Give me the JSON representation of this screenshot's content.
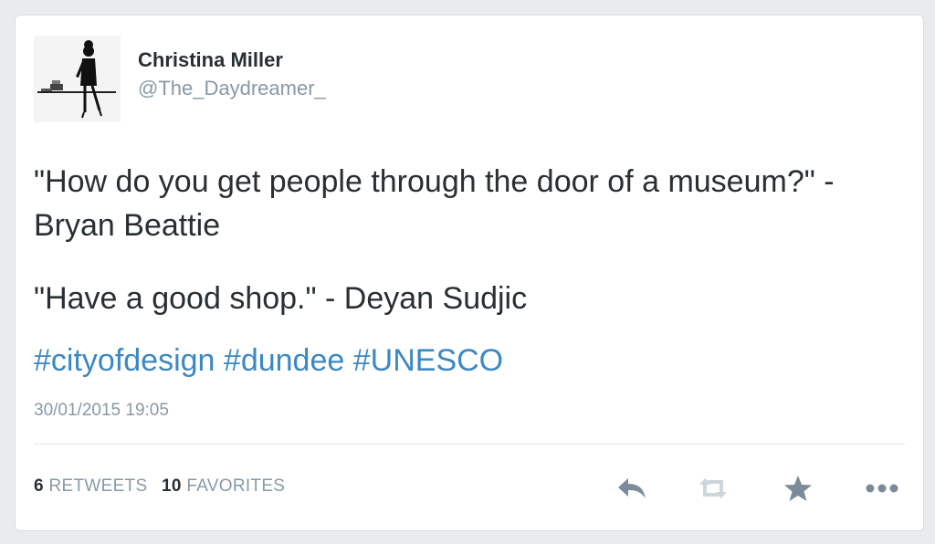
{
  "tweet": {
    "author_name": "Christina Miller",
    "author_handle": "@The_Daydreamer_",
    "paragraphs": [
      "\"How do you get people through the door of a museum?\" - Bryan Beattie",
      "\"Have a good shop.\" - Deyan Sudjic"
    ],
    "hashtags": [
      "#cityofdesign",
      "#dundee",
      "#UNESCO"
    ],
    "timestamp": "30/01/2015 19:05",
    "stats": {
      "retweets_count": "6",
      "retweets_label": "RETWEETS",
      "favorites_count": "10",
      "favorites_label": "FAVORITES"
    }
  },
  "actions": [
    "reply-icon",
    "retweet-icon",
    "favorite-icon",
    "more-icon"
  ],
  "colors": {
    "hashtag": "#3b88c3",
    "text": "#292f33",
    "muted": "#8899a6",
    "action_icon": "#7b8b9a",
    "retweet_icon": "#ccd6dd"
  }
}
